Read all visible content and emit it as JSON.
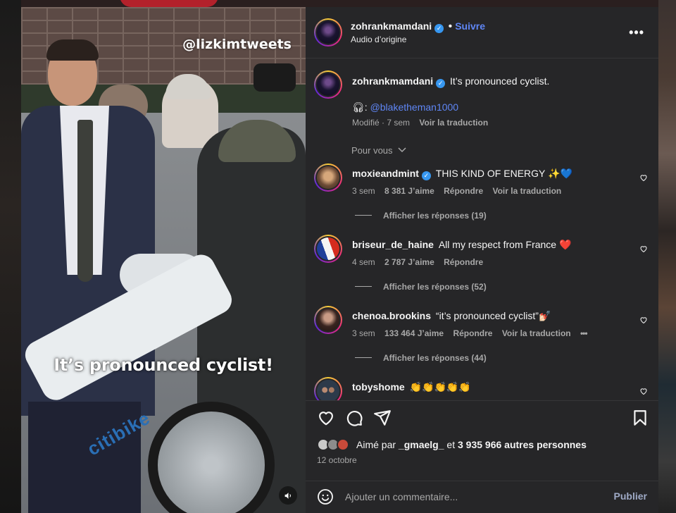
{
  "video": {
    "watermark": "@lizkimtweets",
    "caption": "It’s pronounced cyclist!",
    "bike_brand": "citibike"
  },
  "post": {
    "username": "zohrankmamdani",
    "follow_label": "Suivre",
    "audio_label": "Audio d’origine",
    "more_icon": "more-horizontal-icon"
  },
  "caption_comment": {
    "username": "zohrankmamdani",
    "text": "It’s pronounced cyclist.",
    "audio_credit": "@blaketheman1000",
    "edited": "Modifié",
    "time": "7 sem",
    "translate": "Voir la traduction"
  },
  "for_you_label": "Pour vous",
  "comments": [
    {
      "username": "moxieandmint",
      "verified": true,
      "text": "THIS KIND OF ENERGY ✨💙",
      "time": "3 sem",
      "likes": "8 381 J’aime",
      "reply": "Répondre",
      "translate": "Voir la traduction",
      "replies": "Afficher les réponses (19)"
    },
    {
      "username": "briseur_de_haine",
      "verified": false,
      "text": "All my respect from France ❤️",
      "time": "4 sem",
      "likes": "2 787 J’aime",
      "reply": "Répondre",
      "replies": "Afficher les réponses (52)"
    },
    {
      "username": "chenoa.brookins",
      "verified": false,
      "text": "“it’s pronounced cyclist”💅🏻",
      "time": "3 sem",
      "likes": "133 464 J’aime",
      "reply": "Répondre",
      "translate": "Voir la traduction",
      "more": "•••",
      "replies": "Afficher les réponses (44)"
    },
    {
      "username": "tobyshome",
      "verified": false,
      "text": "👏👏👏👏👏"
    }
  ],
  "liked_by": {
    "prefix": "Aimé par",
    "user": "_gmaelg_",
    "middle": "et",
    "count": "3 935 966 autres personnes"
  },
  "date": "12 octobre",
  "comment_box": {
    "placeholder": "Ajouter un commentaire...",
    "publish": "Publier"
  },
  "colors": {
    "panel_bg": "#262628",
    "accent_blue": "#5f86f5",
    "verified_blue": "#3797f0",
    "muted_text": "#a8a8a8"
  }
}
